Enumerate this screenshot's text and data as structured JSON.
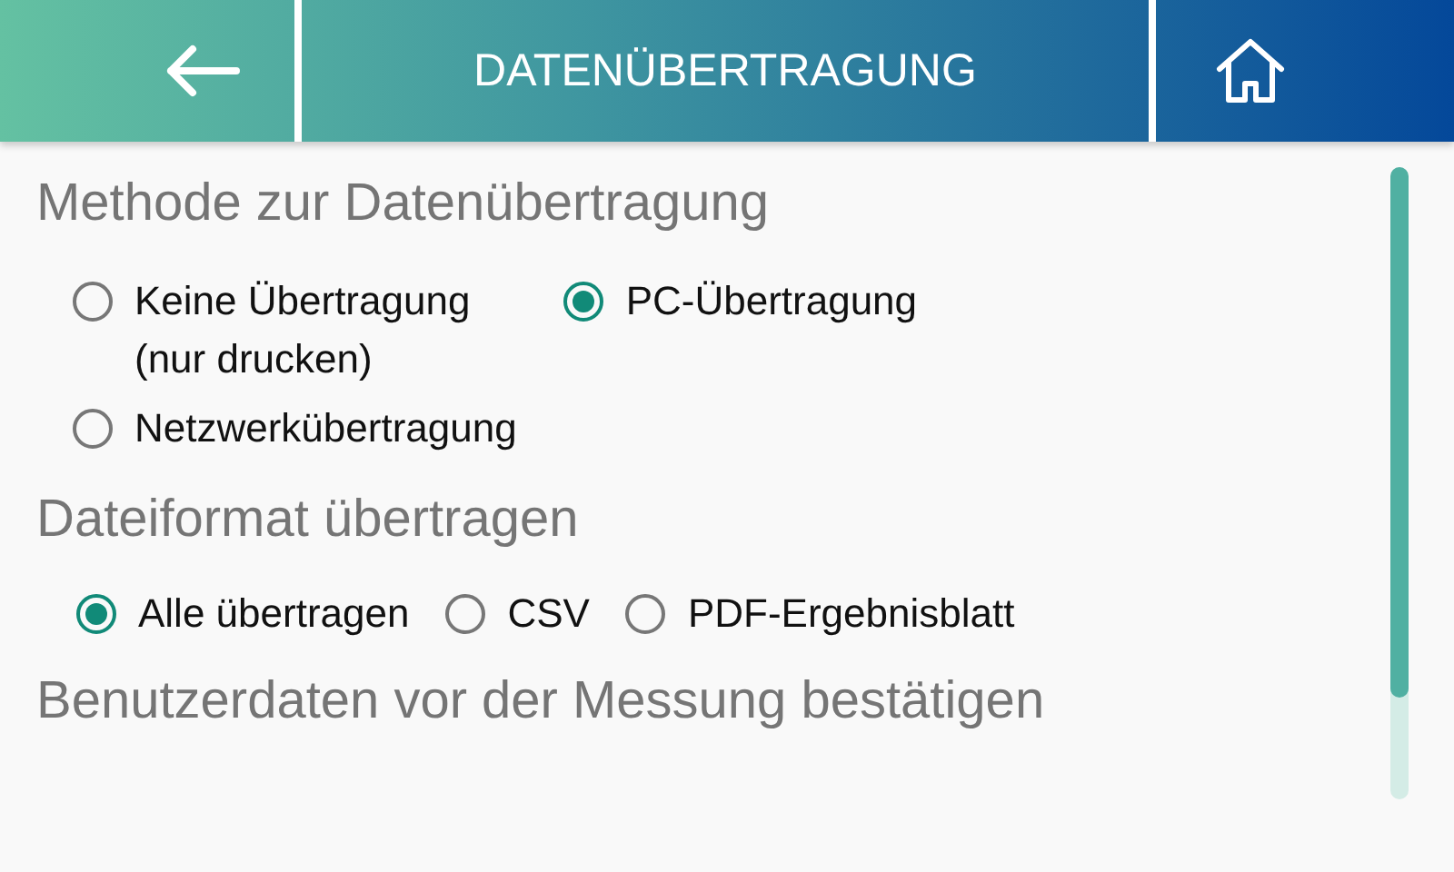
{
  "header": {
    "title": "DATENÜBERTRAGUNG"
  },
  "sections": [
    {
      "heading": "Methode zur Datenübertragung",
      "kind": "grid",
      "options": [
        {
          "label": "Keine Übertragung\n(nur drucken)",
          "selected": false
        },
        {
          "label": "PC-Übertragung",
          "selected": true
        },
        {
          "label": "Netzwerkübertragung",
          "selected": false
        }
      ]
    },
    {
      "heading": "Dateiformat übertragen",
      "kind": "row",
      "options": [
        {
          "label": "Alle übertragen",
          "selected": true
        },
        {
          "label": "CSV",
          "selected": false
        },
        {
          "label": "PDF-Ergebnisblatt",
          "selected": false
        }
      ]
    },
    {
      "heading": "Benutzerdaten vor der Messung bestätigen"
    }
  ]
}
